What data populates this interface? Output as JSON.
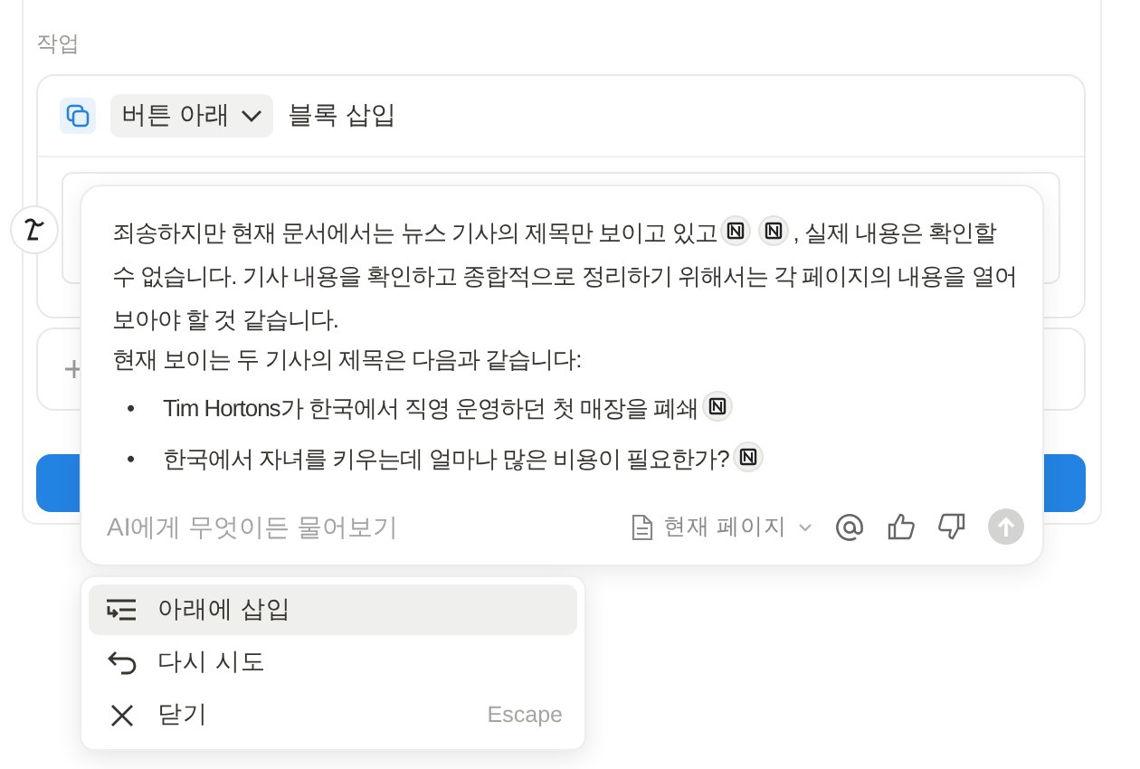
{
  "section_label": "작업",
  "action_card": {
    "position_dropdown": "버튼 아래",
    "action_text": "블록 삽입"
  },
  "ai_response": {
    "paragraphs": [
      {
        "lines": [
          {
            "parts": [
              {
                "kind": "text",
                "text": "죄송하지만 현재 문서에서는 뉴스 기사의 제목만 보이고 있고"
              },
              {
                "kind": "source"
              },
              {
                "kind": "source"
              },
              {
                "kind": "text",
                "text": ", 실제 내용은 확인할"
              }
            ]
          },
          {
            "parts": [
              {
                "kind": "text",
                "text": "수 없습니다. 기사 내용을 확인하고 종합적으로 정리하기 위해서는 각 페이지의 내용을 열어"
              }
            ]
          },
          {
            "parts": [
              {
                "kind": "text",
                "text": "보아야 할 것 같습니다."
              }
            ]
          }
        ]
      },
      {
        "lines": [
          {
            "parts": [
              {
                "kind": "text",
                "text": "현재 보이는 두 기사의 제목은 다음과 같습니다:"
              }
            ]
          }
        ]
      }
    ],
    "bullets": [
      {
        "marker": "•",
        "parts": [
          {
            "kind": "text",
            "text": "Tim Hortons가 한국에서 직영 운영하던 첫 매장을 폐쇄"
          },
          {
            "kind": "source"
          }
        ]
      },
      {
        "marker": "•",
        "parts": [
          {
            "kind": "text",
            "text": "한국에서 자녀를 키우는데 얼마나 많은 비용이 필요한가?"
          },
          {
            "kind": "source"
          }
        ]
      }
    ]
  },
  "prompt": {
    "placeholder": "AI에게 무엇이든 물어보기",
    "context": "현재 페이지",
    "send_disabled": true
  },
  "menu": [
    {
      "label": "아래에 삽입",
      "selected": true
    },
    {
      "label": "다시 시도",
      "selected": false
    },
    {
      "label": "닫기",
      "selected": false,
      "shortcut": "Escape"
    }
  ]
}
